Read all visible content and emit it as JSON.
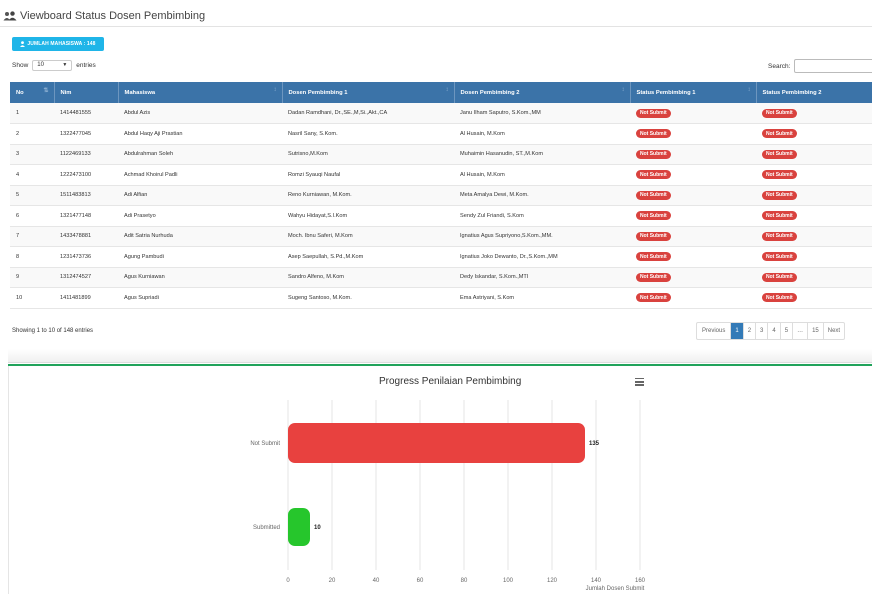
{
  "header": {
    "title": "Viewboard Status Dosen Pembimbing",
    "icon": "users-icon"
  },
  "count_button": {
    "label": "JUMLAH MAHASISWA : 148",
    "icon": "user-icon",
    "color": "#1fb5e8"
  },
  "length_menu": {
    "show_label": "Show",
    "value": "10",
    "entries_label": "entries"
  },
  "search": {
    "label": "Search:",
    "placeholder": ""
  },
  "table": {
    "headers": [
      "No",
      "Nim",
      "Mahasiswa",
      "Dosen Pembimbing 1",
      "Dosen Pembimbing 2",
      "Status Pembimbing 1",
      "Status Pembimbing 2"
    ],
    "header_color": "#3b73a8",
    "rows": [
      [
        "1",
        "1414481555",
        "Abdul Azis",
        "Dadan Ramdhani, Dr.,SE.,M,Si.,Akt.,CA",
        "Janu Ilham Saputro, S.Kom.,MM",
        "Not Submit",
        "Not Submit"
      ],
      [
        "2",
        "1322477045",
        "Abdul Haqy Aji Prastian",
        "Nasril Sany, S.Kom.",
        "Al Husain, M.Kom",
        "Not Submit",
        "Not Submit"
      ],
      [
        "3",
        "1122469133",
        "Abdulrahman Soleh",
        "Sutrisno,M.Kom",
        "Muhaimin Hasanudin, ST.,M.Kom",
        "Not Submit",
        "Not Submit"
      ],
      [
        "4",
        "1222473100",
        "Achmad Khoirul Padli",
        "Romzi Syauqi Naufal",
        "Al Husain, M.Kom",
        "Not Submit",
        "Not Submit"
      ],
      [
        "5",
        "1511483813",
        "Adi Alfian",
        "Reno Kurniawan, M.Kom.",
        "Meta Amalya Dewi, M.Kom.",
        "Not Submit",
        "Not Submit"
      ],
      [
        "6",
        "1321477148",
        "Adi Prasetyo",
        "Wahyu Hidayat,S.I.Kom",
        "Sendy Zul Friandi, S.Kom",
        "Not Submit",
        "Not Submit"
      ],
      [
        "7",
        "1433478881",
        "Adit Satria Nurhuda",
        "Moch. Ibnu Saferi, M.Kom",
        "Ignatius Agus Supriyono,S.Kom.,MM.",
        "Not Submit",
        "Not Submit"
      ],
      [
        "8",
        "1231473736",
        "Agung Pambudi",
        "Asep Saepullah, S.Pd.,M.Kom",
        "Ignatius Joko Dewanto, Dr.,S.Kom.,MM",
        "Not Submit",
        "Not Submit"
      ],
      [
        "9",
        "1312474527",
        "Agus Kurniawan",
        "Sandro Alfeno, M.Kom",
        "Dedy Iskandar, S.Kom.,MTI",
        "Not Submit",
        "Not Submit"
      ],
      [
        "10",
        "1411481899",
        "Agus Supriadi",
        "Sugeng Santoso, M.Kom.",
        "Ema Astriyani, S.Kom",
        "Not Submit",
        "Not Submit"
      ]
    ]
  },
  "footer": {
    "info": "Showing 1 to 10 of 148 entries",
    "pagination": {
      "previous": "Previous",
      "pages": [
        "1",
        "2",
        "3",
        "4",
        "5",
        "…",
        "15"
      ],
      "next": "Next",
      "active": "1"
    }
  },
  "chart_data": {
    "type": "bar",
    "orientation": "horizontal",
    "title": "Progress Penilaian Pembimbing",
    "categories": [
      "Not Submit",
      "Submitted"
    ],
    "values": [
      135,
      10
    ],
    "data_labels": [
      "135",
      "10"
    ],
    "colors": [
      "#e8413f",
      "#26c62c"
    ],
    "xlabel": "Jumlah Dosen Submit",
    "ylabel": "",
    "xlim": [
      0,
      160
    ],
    "x_ticks": [
      "0",
      "20",
      "40",
      "60",
      "80",
      "100",
      "120",
      "140",
      "160"
    ],
    "grid": true,
    "menu_icon": "hamburger-menu-icon"
  }
}
